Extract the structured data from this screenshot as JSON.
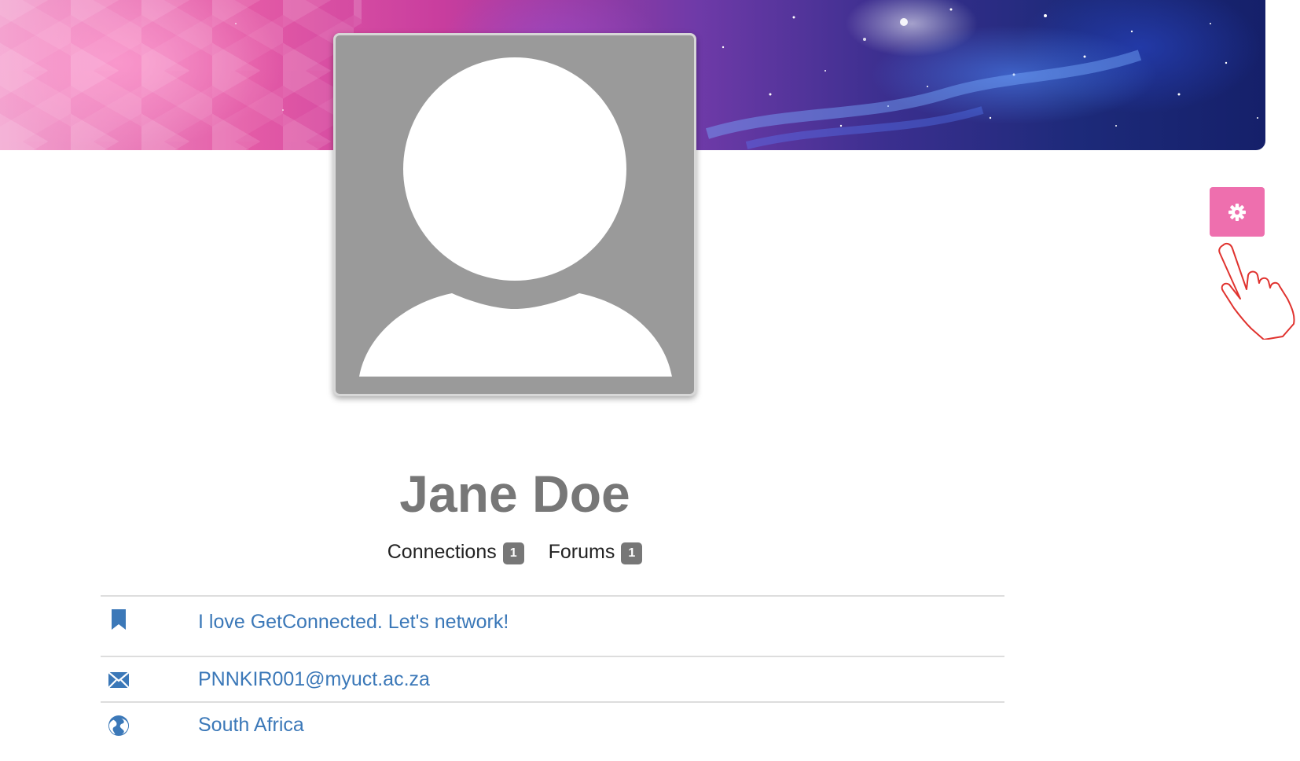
{
  "profile": {
    "name": "Jane Doe"
  },
  "stats": {
    "connections_label": "Connections",
    "connections_count": "1",
    "forums_label": "Forums",
    "forums_count": "1"
  },
  "info": {
    "status": "I love GetConnected. Let's network!",
    "email": "PNNKIR001@myuct.ac.za",
    "country": "South Africa"
  },
  "icons": {
    "settings": "gear-icon",
    "status": "bookmark-icon",
    "email": "envelope-icon",
    "country": "globe-icon",
    "pointer": "hand-pointer-icon"
  },
  "colors": {
    "accent": "#ee6fae",
    "link": "#3b78b8",
    "name": "#777777",
    "badge": "#777777",
    "avatar_bg": "#9a9a9a"
  }
}
